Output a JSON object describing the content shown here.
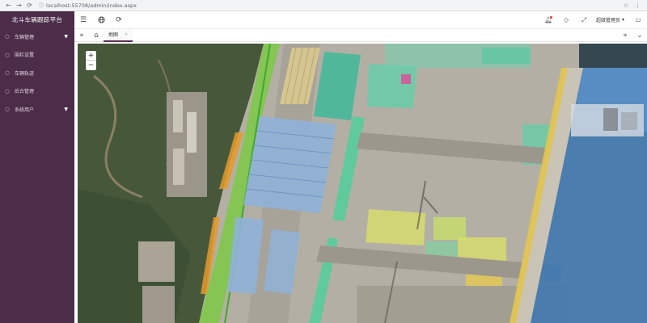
{
  "browser": {
    "url": "localhost:55708/admin/index.aspx"
  },
  "sidebar": {
    "brand": "北斗车辆跟踪平台",
    "items": [
      {
        "label": "车辆管理",
        "has_submenu": true
      },
      {
        "label": "围栏设置",
        "has_submenu": false
      },
      {
        "label": "车辆轨迹",
        "has_submenu": false
      },
      {
        "label": "后台管理",
        "has_submenu": false
      },
      {
        "label": "系统用户",
        "has_submenu": true
      }
    ]
  },
  "header": {
    "user_name": "超级管理员"
  },
  "tabs": [
    {
      "label": "地图"
    }
  ],
  "map": {
    "zoom_in": "+",
    "zoom_out": "−"
  },
  "icons": {
    "menu": "menu-icon",
    "globe": "globe-icon",
    "refresh": "refresh-icon",
    "bell": "bell-icon",
    "tag": "tag-icon",
    "fullscreen": "fullscreen-icon",
    "message": "message-icon"
  },
  "colors": {
    "sidebar_bg": "#4b2c49",
    "notify_dot": "#e53935",
    "sea": "#3f78b0"
  }
}
